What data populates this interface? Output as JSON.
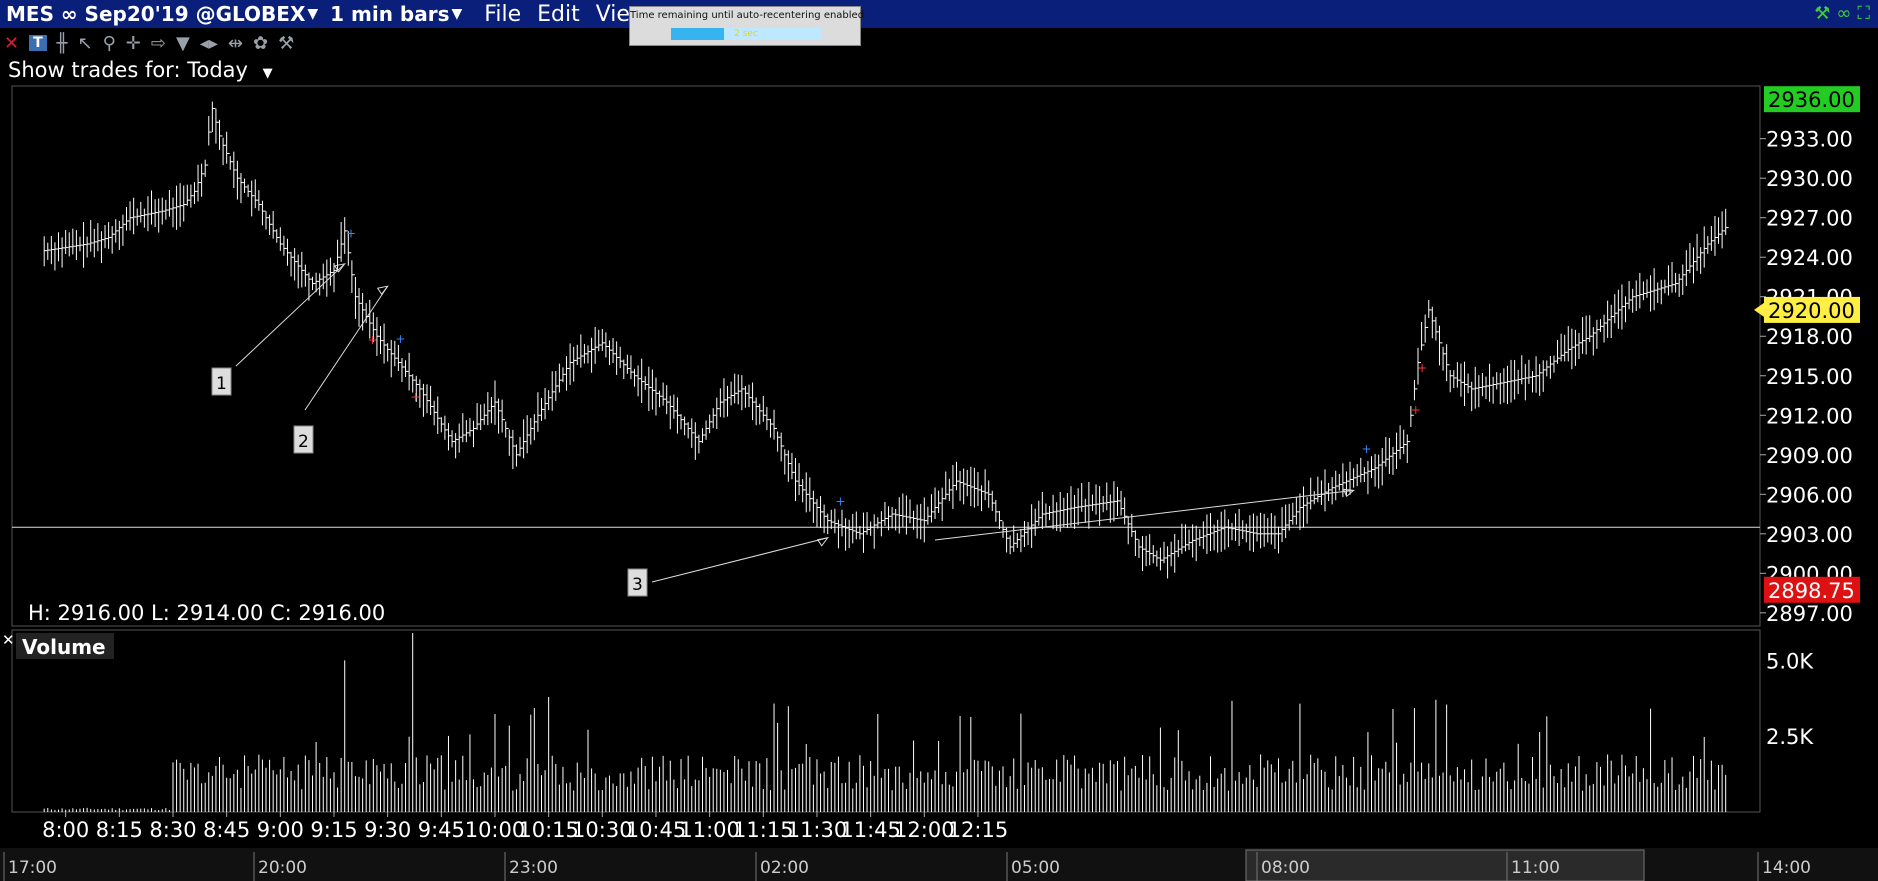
{
  "window": {
    "symbol": "MES ∞ Sep20'19 @GLOBEX",
    "bar_size": "1 min bars",
    "menus": [
      "File",
      "Edit",
      "View"
    ]
  },
  "tooltip": {
    "label": "Time remaining until auto-recentering enabled",
    "value": "2 sec",
    "progress": 0.35
  },
  "show_trades": {
    "label": "Show trades for:",
    "value": "Today"
  },
  "icons": [
    "close-icon",
    "text-tool-icon",
    "bar-chart-icon",
    "pointer-icon",
    "magnifier-icon",
    "crosshair-icon",
    "arrow-icon",
    "triangle-icon",
    "scroll-icon",
    "split-icon",
    "drawing-tools-icon",
    "wrench-icon",
    "link-icon",
    "maximize-icon"
  ],
  "colors": {
    "background": "#000000",
    "title_bar": "#0a1f7a",
    "bar": "#ffffff",
    "price_high_tag": "#22cc22",
    "current_price_tag": "#ffee44",
    "price_low_tag": "#dd1111",
    "buy_marker": "#3388ff",
    "sell_marker": "#ff3333"
  },
  "chart_data": {
    "type": "bar",
    "title": "",
    "ohlc_readout": "H: 2916.00 L: 2914.00 C: 2916.00",
    "price_axis": {
      "ticks": [
        "2897.00",
        "2900.00",
        "2903.00",
        "2906.00",
        "2909.00",
        "2912.00",
        "2915.00",
        "2918.00",
        "2921.00",
        "2924.00",
        "2927.00",
        "2930.00",
        "2933.00"
      ],
      "range": [
        2896,
        2937
      ],
      "high_tag": "2936.00",
      "current_tag": "2920.00",
      "low_tag": "2898.75",
      "reference_line": 2903.5
    },
    "time_axis": {
      "ticks": [
        "8:00",
        "8:15",
        "8:30",
        "8:45",
        "9:00",
        "9:15",
        "9:30",
        "9:45",
        "10:00",
        "10:15",
        "10:30",
        "10:45",
        "11:00",
        "11:15",
        "11:30",
        "11:45",
        "12:00",
        "12:15"
      ]
    },
    "navigator_axis": {
      "ticks": [
        "17:00",
        "20:00",
        "23:00",
        "02:00",
        "05:00",
        "08:00",
        "11:00",
        "14:00"
      ]
    },
    "price_path": [
      [
        7.9,
        2924.5
      ],
      [
        8.1,
        2925
      ],
      [
        8.2,
        2925.5
      ],
      [
        8.3,
        2927
      ],
      [
        8.45,
        2927.5
      ],
      [
        8.55,
        2928
      ],
      [
        8.6,
        2929
      ],
      [
        8.65,
        2931
      ],
      [
        8.68,
        2935.5
      ],
      [
        8.72,
        2933
      ],
      [
        8.8,
        2930
      ],
      [
        8.9,
        2928
      ],
      [
        9.0,
        2925
      ],
      [
        9.05,
        2924
      ],
      [
        9.15,
        2922
      ],
      [
        9.25,
        2923
      ],
      [
        9.3,
        2926
      ],
      [
        9.35,
        2921
      ],
      [
        9.45,
        2918
      ],
      [
        9.55,
        2916
      ],
      [
        9.65,
        2914
      ],
      [
        9.8,
        2910
      ],
      [
        9.9,
        2911
      ],
      [
        10.0,
        2913
      ],
      [
        10.1,
        2909
      ],
      [
        10.2,
        2912
      ],
      [
        10.35,
        2916
      ],
      [
        10.5,
        2917.5
      ],
      [
        10.65,
        2915
      ],
      [
        10.8,
        2913
      ],
      [
        10.95,
        2910
      ],
      [
        11.05,
        2913
      ],
      [
        11.15,
        2914
      ],
      [
        11.3,
        2911
      ],
      [
        11.4,
        2907
      ],
      [
        11.55,
        2904
      ],
      [
        11.7,
        2903
      ],
      [
        11.85,
        2904.5
      ],
      [
        12.0,
        2904
      ],
      [
        12.15,
        2907
      ],
      [
        12.3,
        2906
      ],
      [
        12.4,
        2902
      ],
      [
        12.55,
        2904.5
      ],
      [
        12.7,
        2905
      ],
      [
        12.9,
        2905.5
      ],
      [
        13.0,
        2902
      ],
      [
        13.1,
        2901
      ],
      [
        13.25,
        2902.5
      ],
      [
        13.4,
        2903.5
      ],
      [
        13.55,
        2903
      ],
      [
        13.65,
        2903
      ],
      [
        13.75,
        2905
      ],
      [
        13.9,
        2906.5
      ],
      [
        14.1,
        2908
      ],
      [
        14.25,
        2910
      ],
      [
        14.3,
        2916
      ],
      [
        14.35,
        2920
      ],
      [
        14.45,
        2915
      ],
      [
        14.55,
        2914
      ],
      [
        14.7,
        2914.5
      ],
      [
        14.85,
        2915
      ],
      [
        15.0,
        2917
      ],
      [
        15.1,
        2918
      ],
      [
        15.3,
        2921
      ],
      [
        15.5,
        2922
      ],
      [
        15.65,
        2925
      ],
      [
        15.75,
        2926.5
      ]
    ],
    "volume_axis": {
      "ticks": [
        "5.0K",
        "2.5K"
      ],
      "max": 6000
    },
    "volume_label": "Volume",
    "annotation_labels": [
      "1",
      "2",
      "3"
    ]
  }
}
